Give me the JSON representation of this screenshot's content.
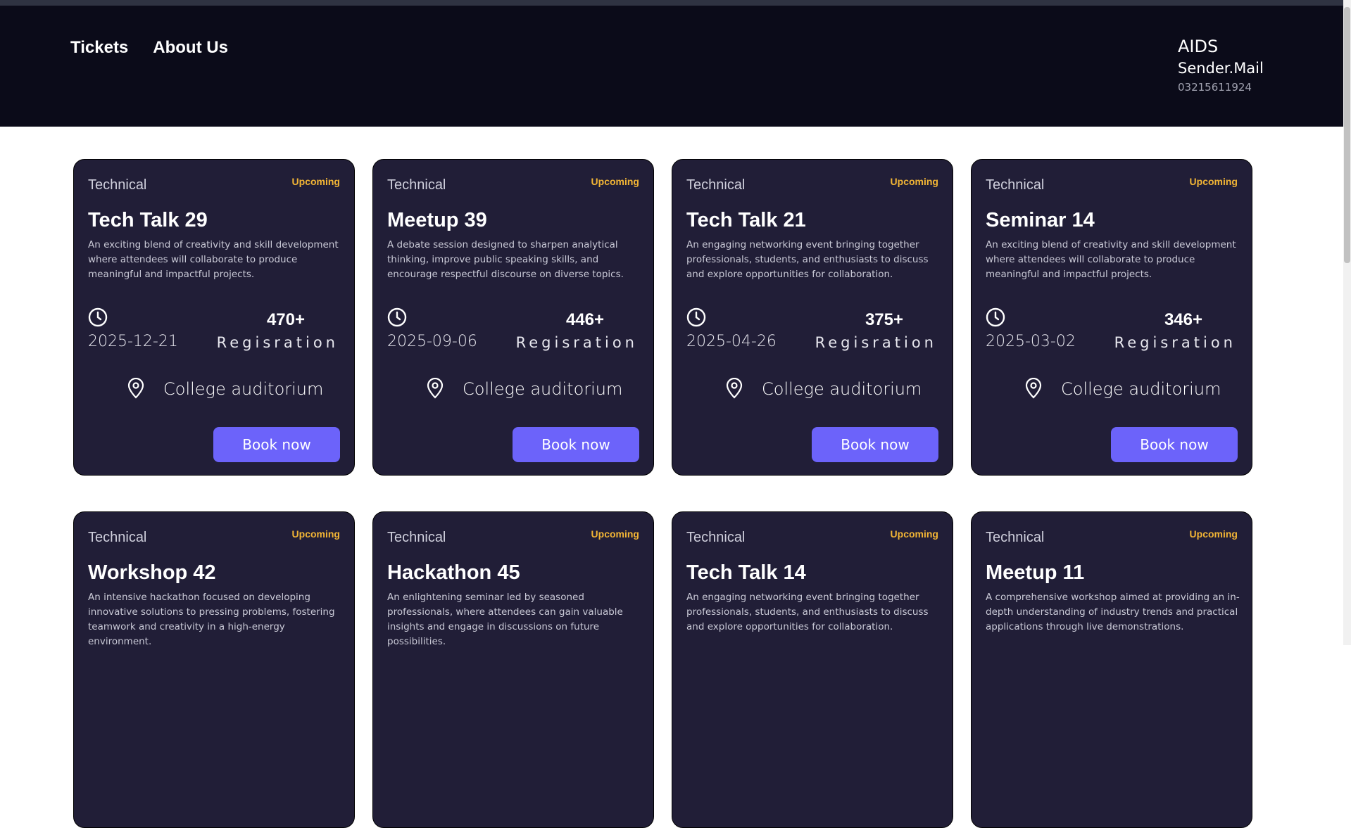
{
  "nav": {
    "tickets": "Tickets",
    "about": "About Us"
  },
  "contact": {
    "name": "AIDS",
    "mail": "Sender.Mail",
    "phone": "03215611924"
  },
  "icons": {
    "clock": "clock-icon",
    "location": "map-pin-icon"
  },
  "colors": {
    "header_bg": "#0b0b19",
    "card_bg": "#211e37",
    "accent": "#6c63fa",
    "status": "#f2b535"
  },
  "cards": [
    {
      "category": "Technical",
      "status": "Upcoming",
      "title": "Tech Talk 29",
      "description": "An exciting blend of creativity and skill development where attendees will collaborate to produce meaningful and impactful projects.",
      "date": "2025-12-21",
      "count": "470+",
      "count_label": "Regisration",
      "venue": "College auditorium",
      "button": "Book now"
    },
    {
      "category": "Technical",
      "status": "Upcoming",
      "title": "Meetup 39",
      "description": "A debate session designed to sharpen analytical thinking, improve public speaking skills, and encourage respectful discourse on diverse topics.",
      "date": "2025-09-06",
      "count": "446+",
      "count_label": "Regisration",
      "venue": "College auditorium",
      "button": "Book now"
    },
    {
      "category": "Technical",
      "status": "Upcoming",
      "title": "Tech Talk 21",
      "description": "An engaging networking event bringing together professionals, students, and enthusiasts to discuss and explore opportunities for collaboration.",
      "date": "2025-04-26",
      "count": "375+",
      "count_label": "Regisration",
      "venue": "College auditorium",
      "button": "Book now"
    },
    {
      "category": "Technical",
      "status": "Upcoming",
      "title": "Seminar 14",
      "description": "An exciting blend of creativity and skill development where attendees will collaborate to produce meaningful and impactful projects.",
      "date": "2025-03-02",
      "count": "346+",
      "count_label": "Regisration",
      "venue": "College auditorium",
      "button": "Book now"
    },
    {
      "category": "Technical",
      "status": "Upcoming",
      "title": "Workshop 42",
      "description": "An intensive hackathon focused on developing innovative solutions to pressing problems, fostering teamwork and creativity in a high-energy environment.",
      "date": "",
      "count": "",
      "count_label": "",
      "venue": "",
      "button": ""
    },
    {
      "category": "Technical",
      "status": "Upcoming",
      "title": "Hackathon 45",
      "description": "An enlightening seminar led by seasoned professionals, where attendees can gain valuable insights and engage in discussions on future possibilities.",
      "date": "",
      "count": "",
      "count_label": "",
      "venue": "",
      "button": ""
    },
    {
      "category": "Technical",
      "status": "Upcoming",
      "title": "Tech Talk 14",
      "description": "An engaging networking event bringing together professionals, students, and enthusiasts to discuss and explore opportunities for collaboration.",
      "date": "",
      "count": "",
      "count_label": "",
      "venue": "",
      "button": ""
    },
    {
      "category": "Technical",
      "status": "Upcoming",
      "title": "Meetup 11",
      "description": "A comprehensive workshop aimed at providing an in-depth understanding of industry trends and practical applications through live demonstrations.",
      "date": "",
      "count": "",
      "count_label": "",
      "venue": "",
      "button": ""
    }
  ]
}
